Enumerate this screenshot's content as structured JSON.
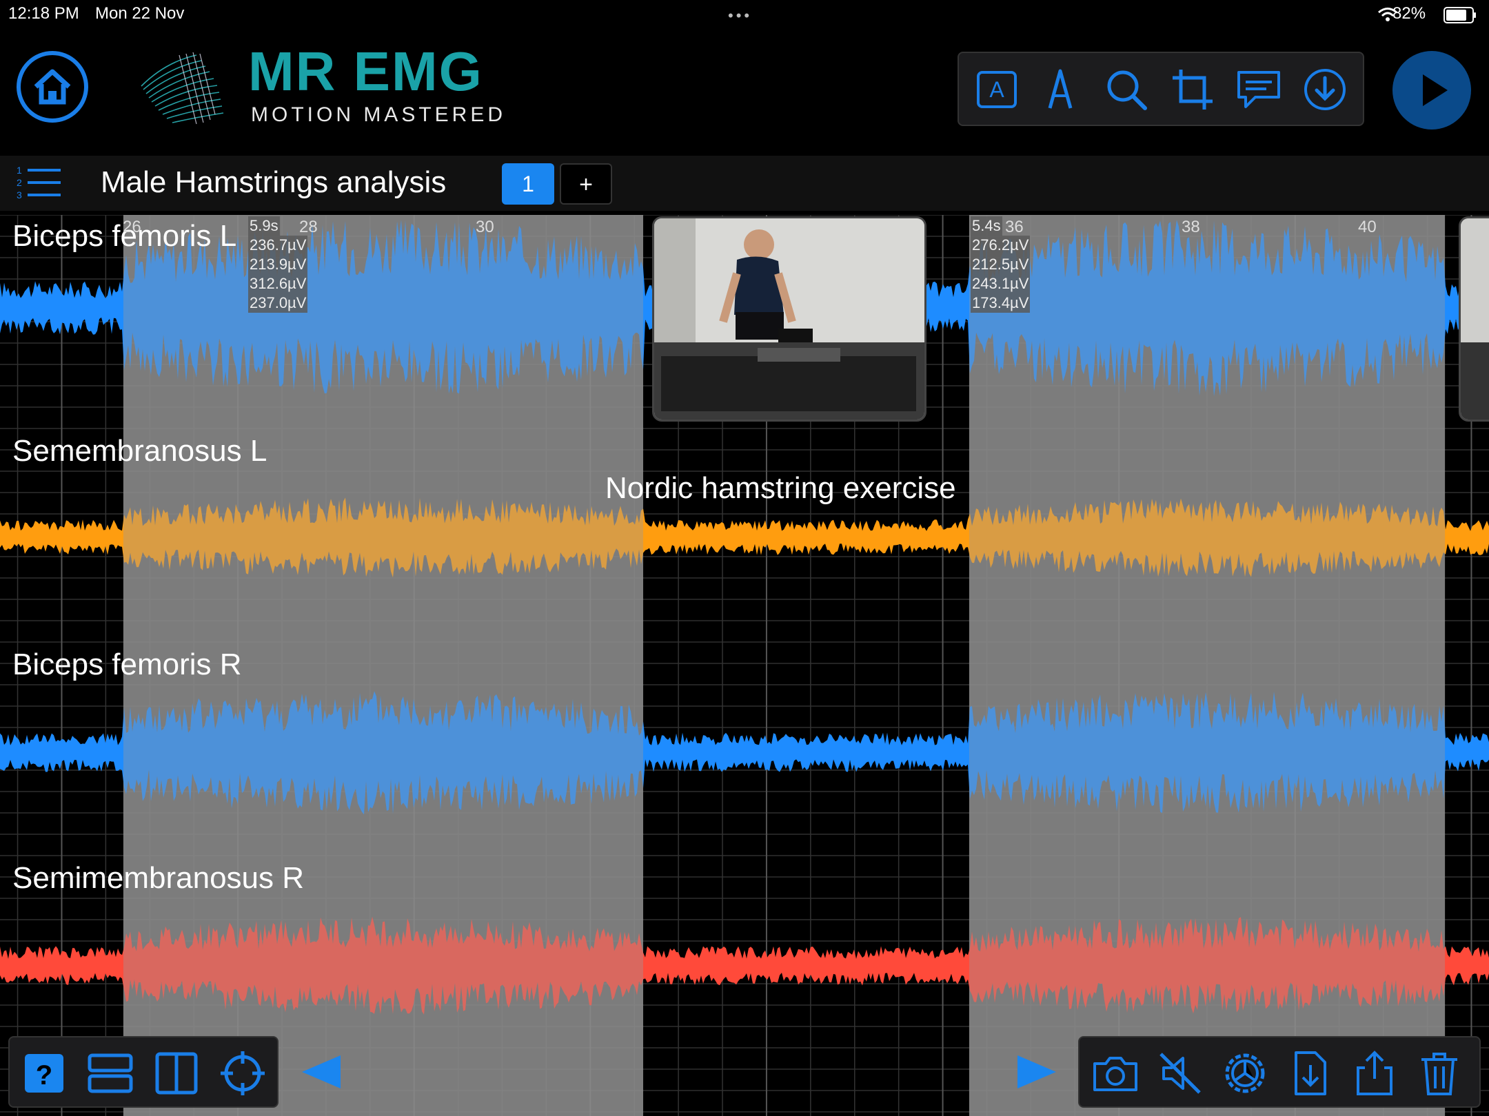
{
  "status_bar": {
    "time": "12:18 PM",
    "date": "Mon 22 Nov",
    "more": "•••",
    "battery": "82%"
  },
  "app": {
    "title": "MR EMG",
    "subtitle": "MOTION MASTERED"
  },
  "document": {
    "title": "Male Hamstrings analysis",
    "pages": [
      "1"
    ],
    "add_page": "+"
  },
  "colors": {
    "accent": "#1a7ee8",
    "bf_blue": "#1e8cff",
    "sm_orange": "#ff9d0f",
    "smr_red": "#ff4a3a",
    "shade": "#808080"
  },
  "icons": {
    "toolbar": [
      "text-box-icon",
      "pen-icon",
      "search-icon",
      "crop-icon",
      "comment-icon",
      "download-icon"
    ],
    "bottom_left": [
      "help-icon",
      "rows-icon",
      "columns-icon",
      "crosshair-icon"
    ],
    "bottom_right": [
      "camera-icon",
      "mute-icon",
      "settings-icon",
      "import-file-icon",
      "share-icon",
      "trash-icon"
    ]
  },
  "chart_data": {
    "type": "area",
    "x_unit": "s",
    "xlim": [
      25.3,
      42.2
    ],
    "x_ticks": [
      "26",
      "28",
      "30",
      "36",
      "38",
      "40"
    ],
    "series": [
      {
        "name": "Biceps femoris L",
        "color": "#1e8cff"
      },
      {
        "name": "Semembranosus L",
        "color": "#ff9d0f"
      },
      {
        "name": "Biceps femoris R",
        "color": "#1e8cff"
      },
      {
        "name": "Semimembranosus R",
        "color": "#ff4a3a"
      }
    ],
    "selections": [
      {
        "start": 26.7,
        "end": 32.6,
        "duration": "5.9s",
        "values": [
          "236.7µV",
          "213.9µV",
          "312.6µV",
          "237.0µV"
        ]
      },
      {
        "start": 36.3,
        "end": 41.7,
        "duration": "5.4s",
        "values": [
          "276.2µV",
          "212.5µV",
          "243.1µV",
          "173.4µV"
        ]
      }
    ],
    "annotation": {
      "text": "Nordic hamstring exercise",
      "x": 34.4
    },
    "grid": true
  }
}
